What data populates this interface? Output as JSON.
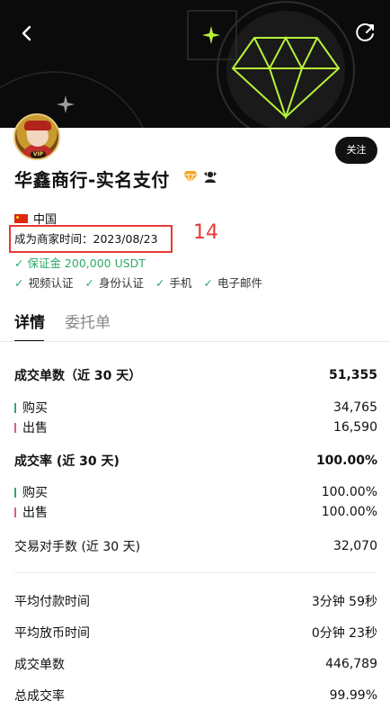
{
  "header": {
    "back_icon": "chevron-left-icon",
    "share_icon": "share-icon"
  },
  "merchant": {
    "avatar_badge": "VIP",
    "name": "华鑫商行-实名支付",
    "follow_label": "关注",
    "country": "中国",
    "merchant_since": "成为商家时间：2023/08/23",
    "annotation_number": "14",
    "deposit": "保证金 200,000 USDT",
    "verifications": [
      "视频认证",
      "身份认证",
      "手机",
      "电子邮件"
    ],
    "badge_icons": [
      "diamond-icon",
      "merchant-icon"
    ]
  },
  "tabs": {
    "details": "详情",
    "orders": "委托单"
  },
  "stats": {
    "orders_30d_label": "成交单数（近 30 天）",
    "orders_30d_value": "51,355",
    "orders_buy_label": "购买",
    "orders_buy_value": "34,765",
    "orders_sell_label": "出售",
    "orders_sell_value": "16,590",
    "rate_30d_label": "成交率 (近 30 天)",
    "rate_30d_value": "100.00%",
    "rate_buy_label": "购买",
    "rate_buy_value": "100.00%",
    "rate_sell_label": "出售",
    "rate_sell_value": "100.00%",
    "counterparties_label": "交易对手数 (近 30 天)",
    "counterparties_value": "32,070",
    "avg_pay_label": "平均付款时间",
    "avg_pay_value": "3分钟 59秒",
    "avg_release_label": "平均放币时间",
    "avg_release_value": "0分钟 23秒",
    "total_orders_label": "成交单数",
    "total_orders_value": "446,789",
    "total_rate_label": "总成交率",
    "total_rate_value": "99.99%"
  },
  "colors": {
    "accent_green": "#2eaa6a",
    "sell_pink": "#e25b7a",
    "highlight_red": "#e53935",
    "banner_bg": "#0b0b0b",
    "diamond_neon": "#b7f23a"
  }
}
